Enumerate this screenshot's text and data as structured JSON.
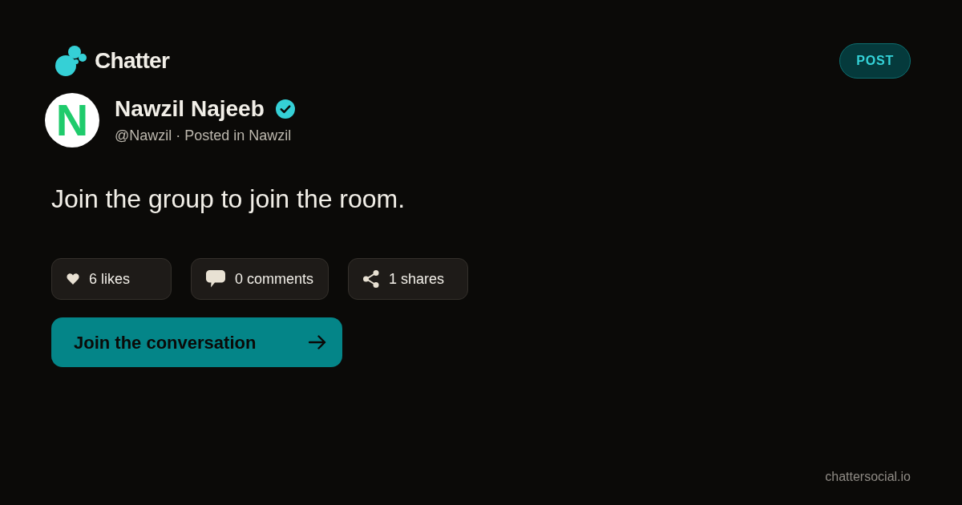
{
  "brand": {
    "name": "Chatter"
  },
  "post_button": {
    "label": "POST"
  },
  "author": {
    "avatar_letter": "N",
    "name": "Nawzil Najeeb",
    "verified": true,
    "subtitle": "@Nawzil · Posted in Nawzil"
  },
  "post": {
    "text": "Join the group to join the room."
  },
  "stats": [
    {
      "kind": "likes",
      "label": "6 likes"
    },
    {
      "kind": "comments",
      "label": "0 comments"
    },
    {
      "kind": "shares",
      "label": "1 shares"
    }
  ],
  "cta": {
    "label": "Join the conversation"
  },
  "footer": {
    "domain": "chattersocial.io"
  }
}
